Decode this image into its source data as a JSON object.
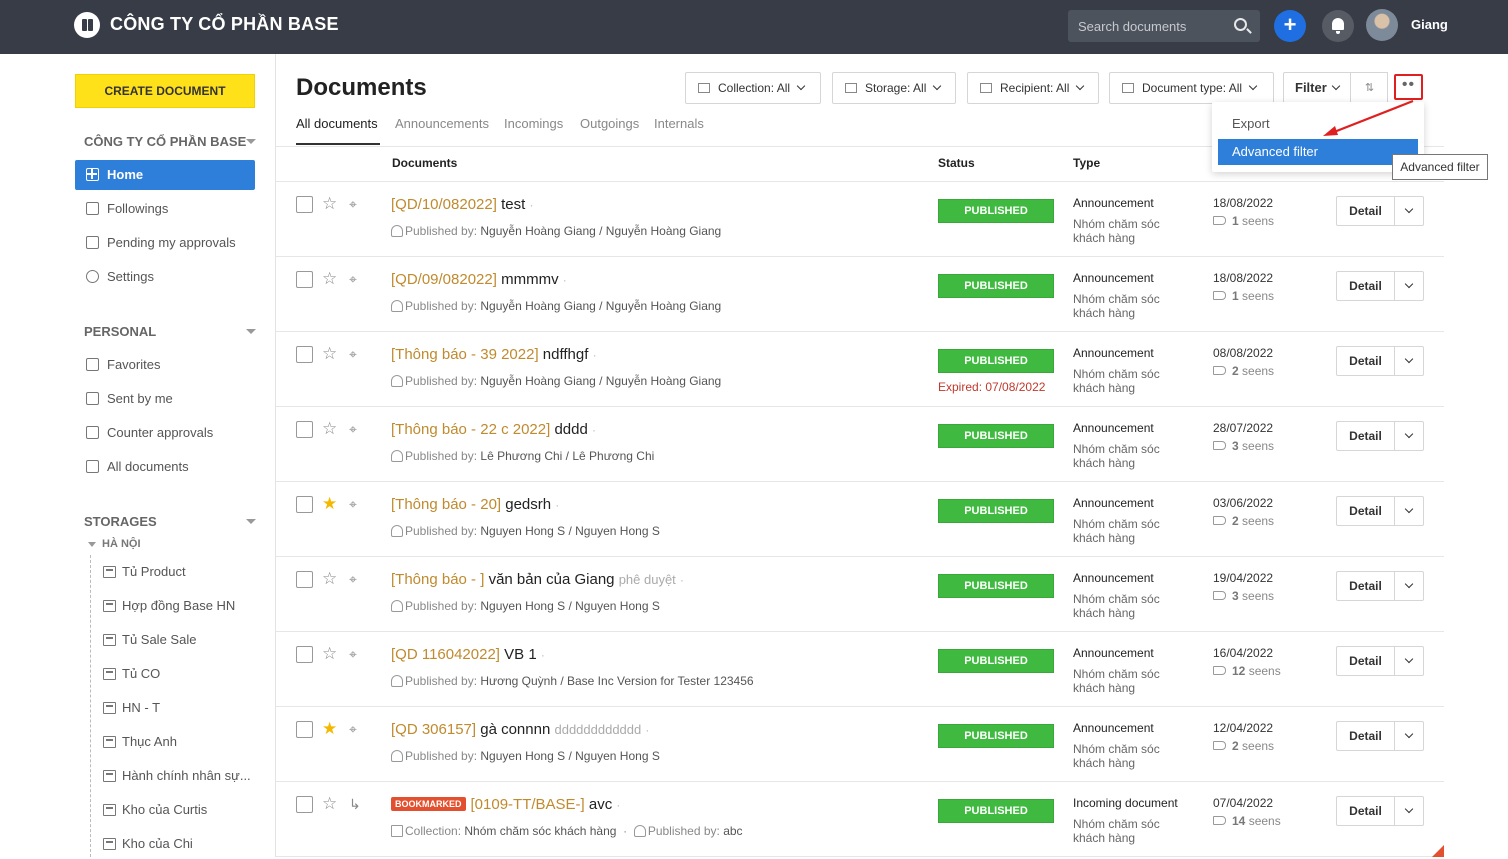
{
  "topbar": {
    "company": "CÔNG TY CỔ PHẦN BASE",
    "search_placeholder": "Search documents",
    "user": "Giang",
    "add": "+"
  },
  "sidebar": {
    "create": "CREATE DOCUMENT",
    "section1": "CÔNG TY CỔ PHẦN BASE",
    "nav": [
      "Home",
      "Followings",
      "Pending my approvals",
      "Settings"
    ],
    "section2": "PERSONAL",
    "personal": [
      "Favorites",
      "Sent by me",
      "Counter approvals",
      "All documents"
    ],
    "section3": "STORAGES",
    "storage_group": "HÀ NỘI",
    "storages": [
      "Tủ Product",
      "Hợp đồng Base HN",
      "Tủ Sale Sale",
      "Tủ CO",
      "HN - T",
      "Thục Anh",
      "Hành chính nhân sự...",
      "Kho của Curtis",
      "Kho của Chi"
    ]
  },
  "main": {
    "title": "Documents",
    "tabs": [
      "All documents",
      "Announcements",
      "Incomings",
      "Outgoings",
      "Internals"
    ],
    "filters": {
      "collection": "Collection: All",
      "storage": "Storage: All",
      "recipient": "Recipient: All",
      "doctype": "Document type: All",
      "filter": "Filter",
      "sort": "⇅",
      "more": "••"
    },
    "dropdown": {
      "export": "Export",
      "advanced": "Advanced filter"
    },
    "tooltip": "Advanced filter",
    "columns": {
      "documents": "Documents",
      "status": "Status",
      "type": "Type"
    }
  },
  "rows": [
    {
      "code": "[QD/10/082022]",
      "title": "test",
      "extra": "",
      "pub_label": "Published by:",
      "pub": "Nguyễn Hoàng Giang / Nguyễn Hoàng Giang",
      "status": "PUBLISHED",
      "expired": "",
      "type": "Announcement",
      "group": "Nhóm chăm sóc khách hàng",
      "date": "18/08/2022",
      "seens_n": "1",
      "seens_t": "seens",
      "starred": false,
      "bookmarked": false,
      "collection": ""
    },
    {
      "code": "[QD/09/082022]",
      "title": "mmmmv",
      "extra": "",
      "pub_label": "Published by:",
      "pub": "Nguyễn Hoàng Giang / Nguyễn Hoàng Giang",
      "status": "PUBLISHED",
      "expired": "",
      "type": "Announcement",
      "group": "Nhóm chăm sóc khách hàng",
      "date": "18/08/2022",
      "seens_n": "1",
      "seens_t": "seens",
      "starred": false,
      "bookmarked": false,
      "collection": ""
    },
    {
      "code": "[Thông báo - 39 2022]",
      "title": "ndffhgf",
      "extra": "",
      "pub_label": "Published by:",
      "pub": "Nguyễn Hoàng Giang / Nguyễn Hoàng Giang",
      "status": "PUBLISHED",
      "expired": "Expired: 07/08/2022",
      "type": "Announcement",
      "group": "Nhóm chăm sóc khách hàng",
      "date": "08/08/2022",
      "seens_n": "2",
      "seens_t": "seens",
      "starred": false,
      "bookmarked": false,
      "collection": ""
    },
    {
      "code": "[Thông báo - 22 c 2022]",
      "title": "dddd",
      "extra": "",
      "pub_label": "Published by:",
      "pub": "Lê Phương Chi / Lê Phương Chi",
      "status": "PUBLISHED",
      "expired": "",
      "type": "Announcement",
      "group": "Nhóm chăm sóc khách hàng",
      "date": "28/07/2022",
      "seens_n": "3",
      "seens_t": "seens",
      "starred": false,
      "bookmarked": false,
      "collection": ""
    },
    {
      "code": "[Thông báo - 20]",
      "title": "gedsrh",
      "extra": "",
      "pub_label": "Published by:",
      "pub": "Nguyen Hong S / Nguyen Hong S",
      "status": "PUBLISHED",
      "expired": "",
      "type": "Announcement",
      "group": "Nhóm chăm sóc khách hàng",
      "date": "03/06/2022",
      "seens_n": "2",
      "seens_t": "seens",
      "starred": true,
      "bookmarked": false,
      "collection": ""
    },
    {
      "code": "[Thông báo - ]",
      "title": "văn bản của Giang",
      "extra": "phê duyệt",
      "pub_label": "Published by:",
      "pub": "Nguyen Hong S / Nguyen Hong S",
      "status": "PUBLISHED",
      "expired": "",
      "type": "Announcement",
      "group": "Nhóm chăm sóc khách hàng",
      "date": "19/04/2022",
      "seens_n": "3",
      "seens_t": "seens",
      "starred": false,
      "bookmarked": false,
      "collection": ""
    },
    {
      "code": "[QD 116042022]",
      "title": "VB 1",
      "extra": "",
      "pub_label": "Published by:",
      "pub": "Hương Quỳnh / Base Inc Version for Tester 123456",
      "status": "PUBLISHED",
      "expired": "",
      "type": "Announcement",
      "group": "Nhóm chăm sóc khách hàng",
      "date": "16/04/2022",
      "seens_n": "12",
      "seens_t": "seens",
      "starred": false,
      "bookmarked": false,
      "collection": ""
    },
    {
      "code": "[QD 306157]",
      "title": "gà connnn",
      "extra": "dddddddddddd",
      "pub_label": "Published by:",
      "pub": "Nguyen Hong S / Nguyen Hong S",
      "status": "PUBLISHED",
      "expired": "",
      "type": "Announcement",
      "group": "Nhóm chăm sóc khách hàng",
      "date": "12/04/2022",
      "seens_n": "2",
      "seens_t": "seens",
      "starred": true,
      "bookmarked": false,
      "collection": ""
    },
    {
      "code": "[0109-TT/BASE-]",
      "title": "avc",
      "extra": "",
      "pub_label": "Published by:",
      "pub": "abc",
      "status": "PUBLISHED",
      "expired": "",
      "type": "Incoming document",
      "group": "Nhóm chăm sóc khách hàng",
      "date": "07/04/2022",
      "seens_n": "14",
      "seens_t": "seens",
      "starred": false,
      "bookmarked": true,
      "bookmark_label": "BOOKMARKED",
      "collection_label": "Collection:",
      "collection": "Nhóm chăm sóc khách hàng"
    }
  ],
  "detail_label": "Detail",
  "colors": {
    "topbar": "#373c46",
    "accent": "#2e7fd9",
    "published": "#3fb93f",
    "create": "#ffe11a",
    "code": "#c08a2e"
  }
}
